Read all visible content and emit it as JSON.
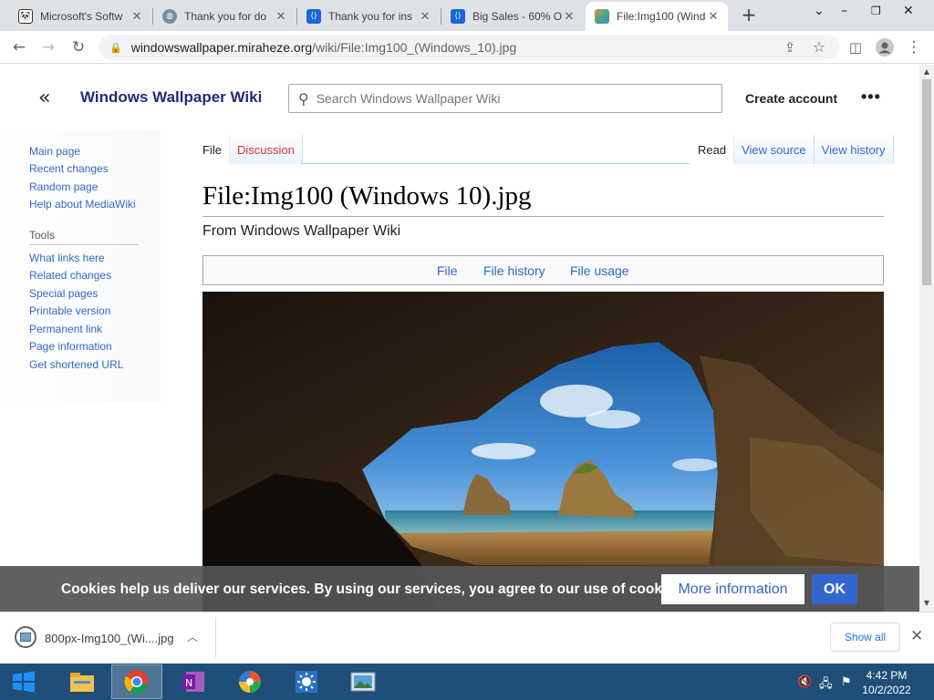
{
  "browser": {
    "tabs": [
      {
        "title": "Microsoft's Softw",
        "icon": "panda-icon"
      },
      {
        "title": "Thank you for do",
        "icon": "globe-icon"
      },
      {
        "title": "Thank you for ins",
        "icon": "code-brackets-icon"
      },
      {
        "title": "Big Sales - 60% O",
        "icon": "code-brackets-icon"
      },
      {
        "title": "File:Img100 (Wind",
        "icon": "wallpaper-icon",
        "active": true
      }
    ],
    "url_host": "windowswallpaper.miraheze.org",
    "url_path": "/wiki/File:Img100_(Windows_10).jpg"
  },
  "wiki": {
    "site_name": "Windows Wallpaper Wiki",
    "search_placeholder": "Search Windows Wallpaper Wiki",
    "create_account": "Create account",
    "more_menu": "•••",
    "nav": [
      "Main page",
      "Recent changes",
      "Random page",
      "Help about MediaWiki"
    ],
    "tools_heading": "Tools",
    "tools": [
      "What links here",
      "Related changes",
      "Special pages",
      "Printable version",
      "Permanent link",
      "Page information",
      "Get shortened URL"
    ],
    "tab_file": "File",
    "tab_discussion": "Discussion",
    "tab_read": "Read",
    "tab_view_source": "View source",
    "tab_view_history": "View history",
    "title": "File:Img100 (Windows 10).jpg",
    "subtitle": "From Windows Wallpaper Wiki",
    "file_toc": [
      "File",
      "File history",
      "File usage"
    ]
  },
  "cookie": {
    "text": "Cookies help us deliver our services. By using our services, you agree to our use of cookies.",
    "more": "More information",
    "ok": "OK"
  },
  "download": {
    "filename": "800px-Img100_(Wi....jpg",
    "show_all": "Show all"
  },
  "taskbar": {
    "time": "4:42 PM",
    "date": "10/2/2022"
  }
}
